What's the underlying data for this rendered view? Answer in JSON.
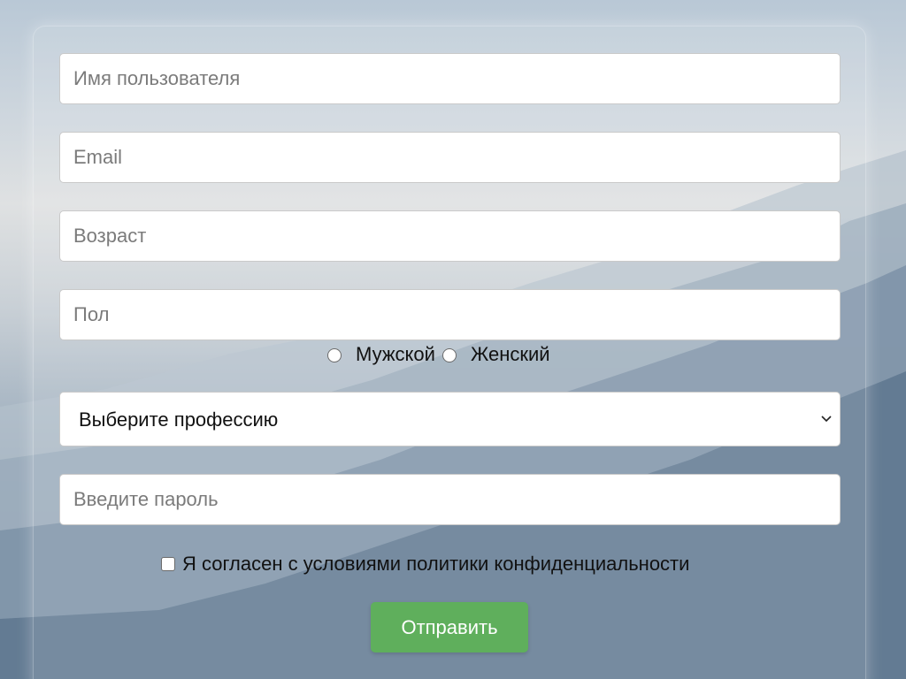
{
  "form": {
    "username": {
      "placeholder": "Имя пользователя",
      "value": ""
    },
    "email": {
      "placeholder": "Email",
      "value": ""
    },
    "age": {
      "placeholder": "Возраст",
      "value": ""
    },
    "gender": {
      "placeholder": "Пол",
      "value": ""
    },
    "gender_options": {
      "male": "Мужской",
      "female": "Женский"
    },
    "profession": {
      "selected": "Выберите профессию"
    },
    "password": {
      "placeholder": "Введите пароль",
      "value": ""
    },
    "consent_label": "Я согласен с условиями политики конфиденциальности",
    "submit_label": "Отправить"
  },
  "colors": {
    "submit": "#5faf5c",
    "field_border": "#c9c9c9"
  },
  "icons": {
    "select": "chevron-down-icon"
  }
}
